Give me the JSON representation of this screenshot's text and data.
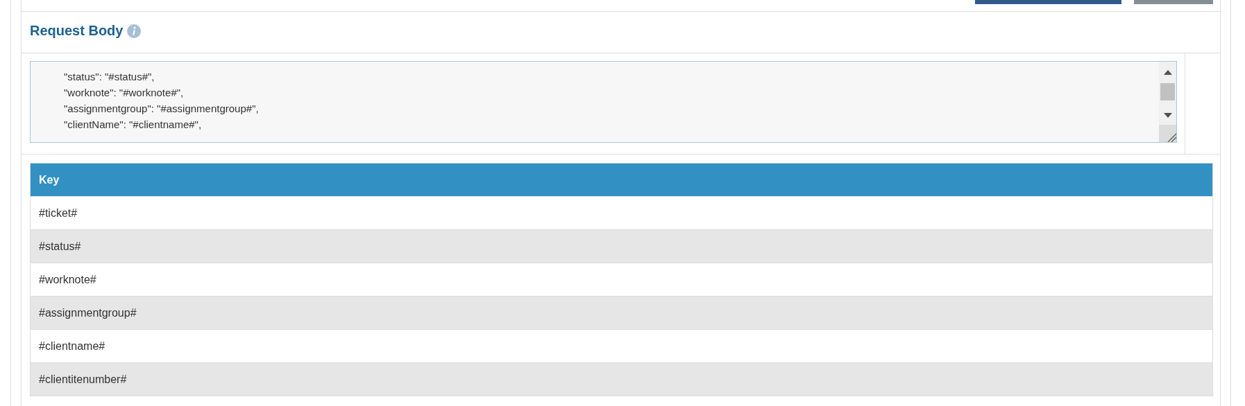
{
  "section": {
    "title": "Request Body"
  },
  "request_body": {
    "lines": [
      "\"status\": \"#status#\",",
      "\"worknote\": \"#worknote#\",",
      "\"assignmentgroup\": \"#assignmentgroup#\",",
      "\"clientName\": \"#clientname#\","
    ]
  },
  "table": {
    "columns": [
      "Key"
    ],
    "rows": [
      {
        "key": "#ticket#"
      },
      {
        "key": "#status#"
      },
      {
        "key": "#worknote#"
      },
      {
        "key": "#assignmentgroup#"
      },
      {
        "key": "#clientname#"
      },
      {
        "key": "#clientitenumber#"
      }
    ]
  }
}
